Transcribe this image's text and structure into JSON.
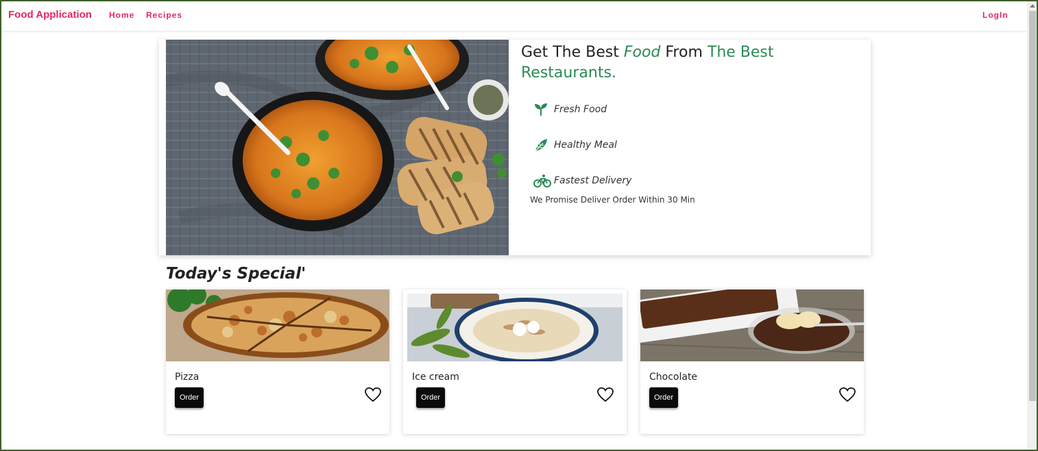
{
  "navbar": {
    "brand": "Food Application",
    "links": {
      "home": "Home",
      "recipes": "Recipes"
    },
    "login": "LogIn",
    "brand_color": "#e8245e"
  },
  "hero": {
    "title_part1": "Get The Best ",
    "title_em": "Food",
    "title_part2": " From ",
    "title_green": "The Best Restaurants.",
    "accent_color": "#2a8a55",
    "features": [
      {
        "icon": "sprout-icon",
        "label": "Fresh Food"
      },
      {
        "icon": "leaf-icon",
        "label": "Healthy Meal"
      },
      {
        "icon": "bicycle-icon",
        "label": "Fastest Delivery"
      }
    ],
    "promise": "We Promise Deliver Order Within 30 Min",
    "image": "soup-bowls-with-toast"
  },
  "specials": {
    "title": "Today's Special'",
    "items": [
      {
        "name": "Pizza",
        "button": "Order",
        "image": "pizza",
        "icon": "heart-outline-icon"
      },
      {
        "name": "Ice cream",
        "button": "Order",
        "image": "ice-cream-bowl",
        "icon": "heart-outline-icon"
      },
      {
        "name": "Chocolate",
        "button": "Order",
        "image": "chocolate-dessert",
        "icon": "heart-outline-icon"
      }
    ]
  }
}
